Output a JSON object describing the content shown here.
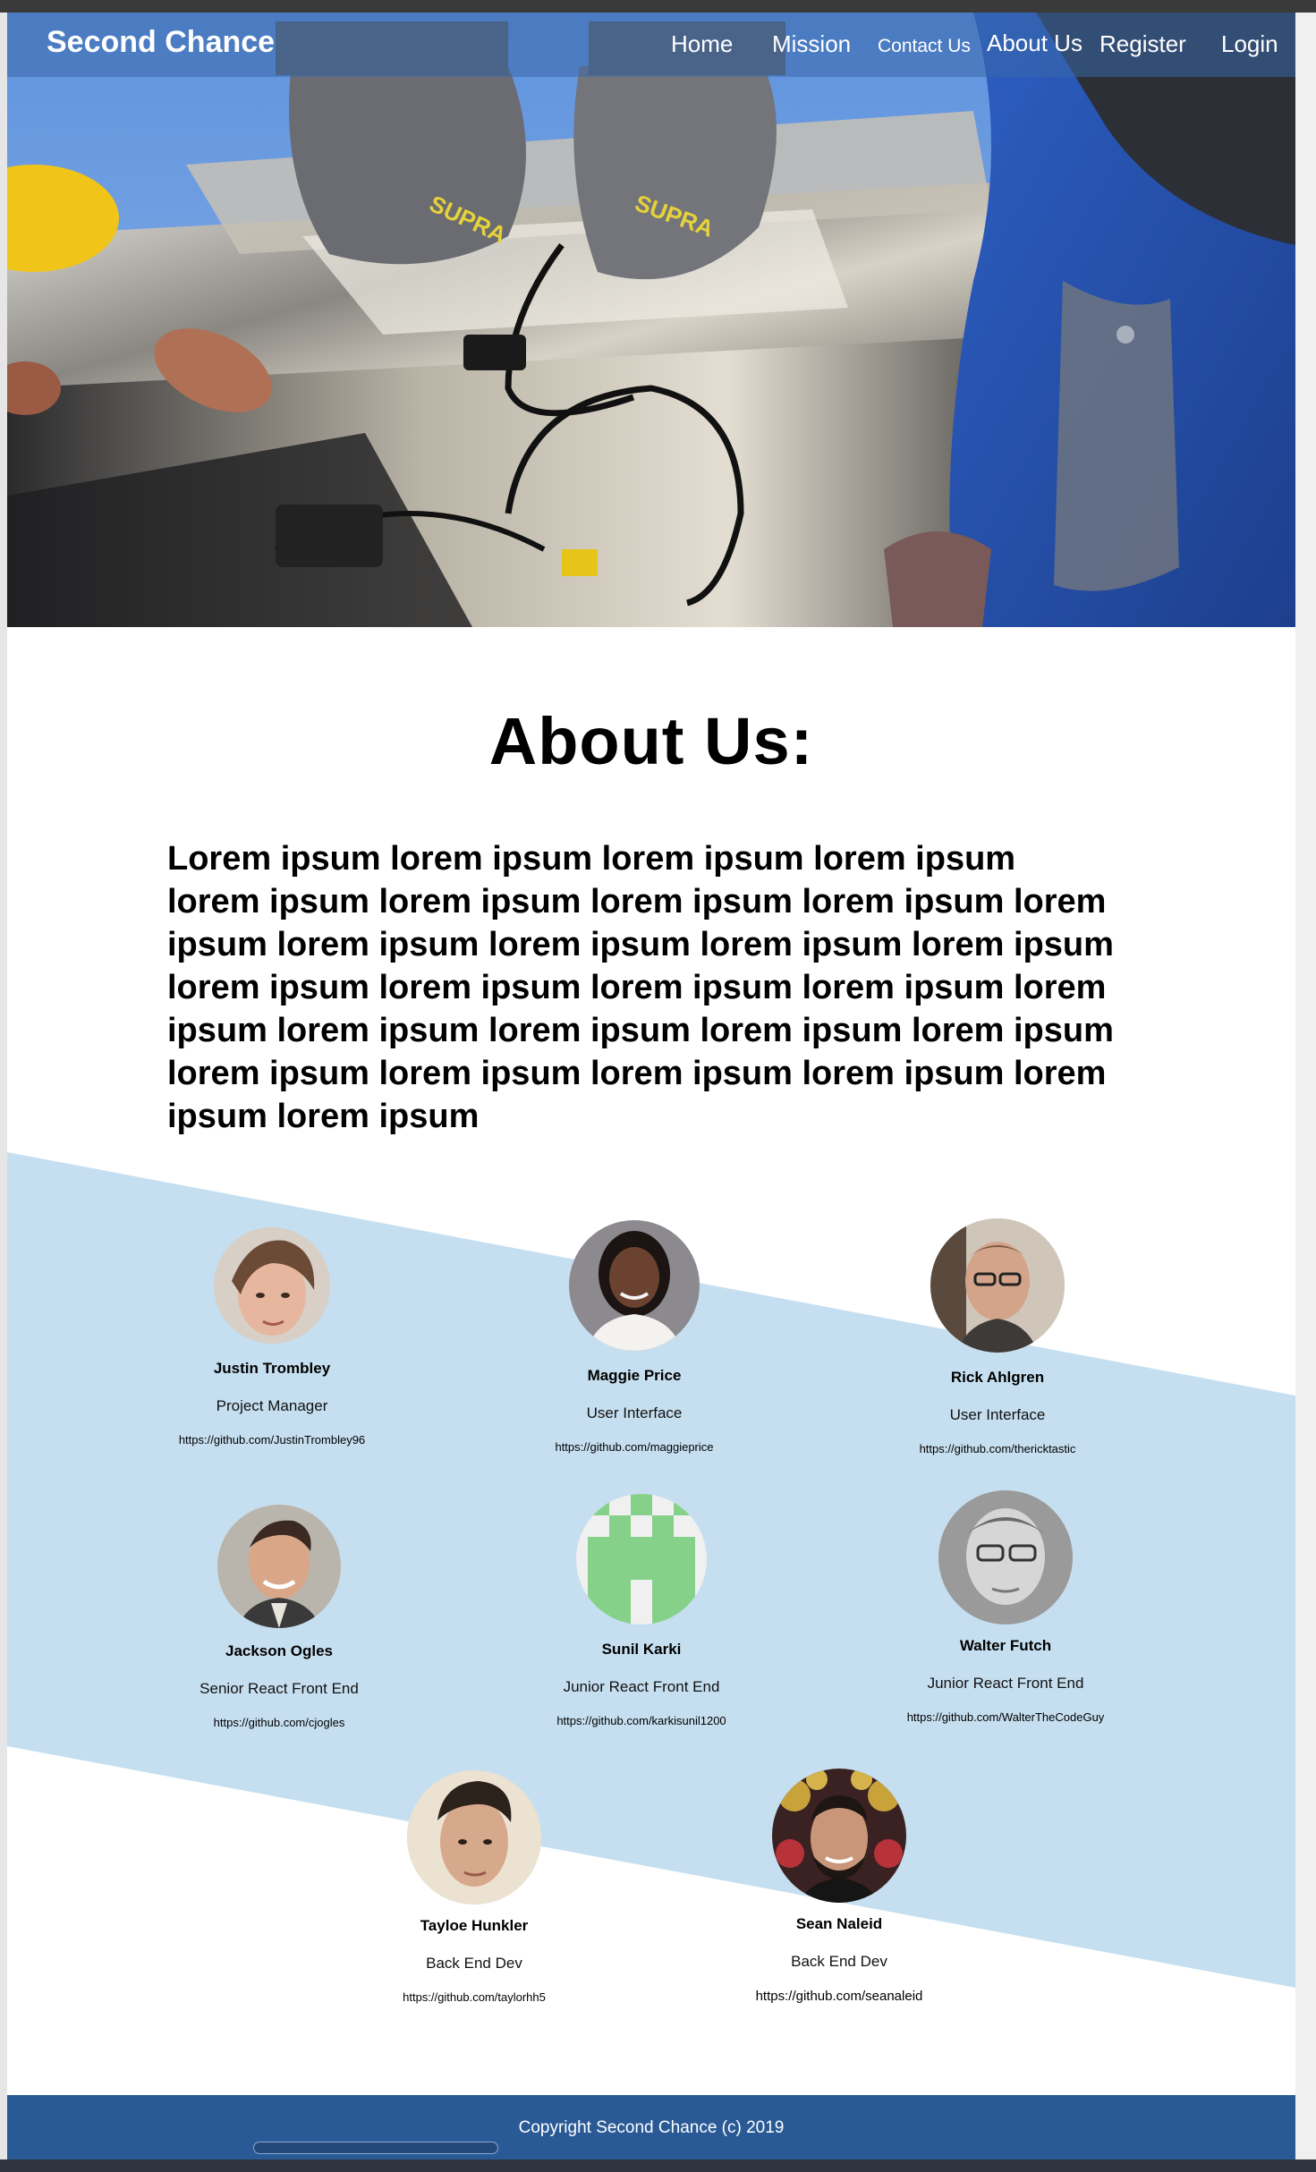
{
  "brand": "Second Chance",
  "nav": {
    "home": "Home",
    "mission": "Mission",
    "contact": "Contact Us",
    "about": "About Us",
    "register": "Register",
    "login": "Login"
  },
  "about": {
    "title": "About Us:",
    "text": "Lorem ipsum lorem ipsum lorem ipsum lorem ipsum lorem ipsum lorem ipsum lorem ipsum lorem ipsum lorem ipsum lorem ipsum  lorem ipsum lorem ipsum lorem ipsum lorem ipsum lorem ipsum lorem ipsum lorem ipsum lorem ipsum lorem ipsum  lorem ipsum lorem ipsum lorem ipsum lorem ipsum lorem ipsum lorem ipsum lorem ipsum lorem ipsum lorem ipsum"
  },
  "team": [
    {
      "name": "Justin Trombley",
      "role": "Project Manager",
      "link": "https://github.com/JustinTrombley96"
    },
    {
      "name": "Maggie Price",
      "role": "User Interface",
      "link": "https://github.com/maggieprice"
    },
    {
      "name": "Rick Ahlgren",
      "role": "User Interface",
      "link": "https://github.com/thericktastic"
    },
    {
      "name": "Jackson Ogles",
      "role": "Senior React Front End",
      "link": "https://github.com/cjogles"
    },
    {
      "name": "Sunil Karki",
      "role": "Junior React Front End",
      "link": "https://github.com/karkisunil1200"
    },
    {
      "name": "Walter Futch",
      "role": "Junior React Front End",
      "link": "https://github.com/WalterTheCodeGuy"
    },
    {
      "name": "Tayloe Hunkler",
      "role": "Back End Dev",
      "link": "https://github.com/taylorhh5"
    },
    {
      "name": "Sean Naleid",
      "role": "Back End Dev",
      "link": "https://github.com/seanaleid"
    }
  ],
  "footer": {
    "copyright": "Copyright Second Chance (c) 2019"
  },
  "colors": {
    "nav_overlay": "#3a68aa",
    "team_band": "#c6dff0",
    "footer": "#2a5a96"
  }
}
